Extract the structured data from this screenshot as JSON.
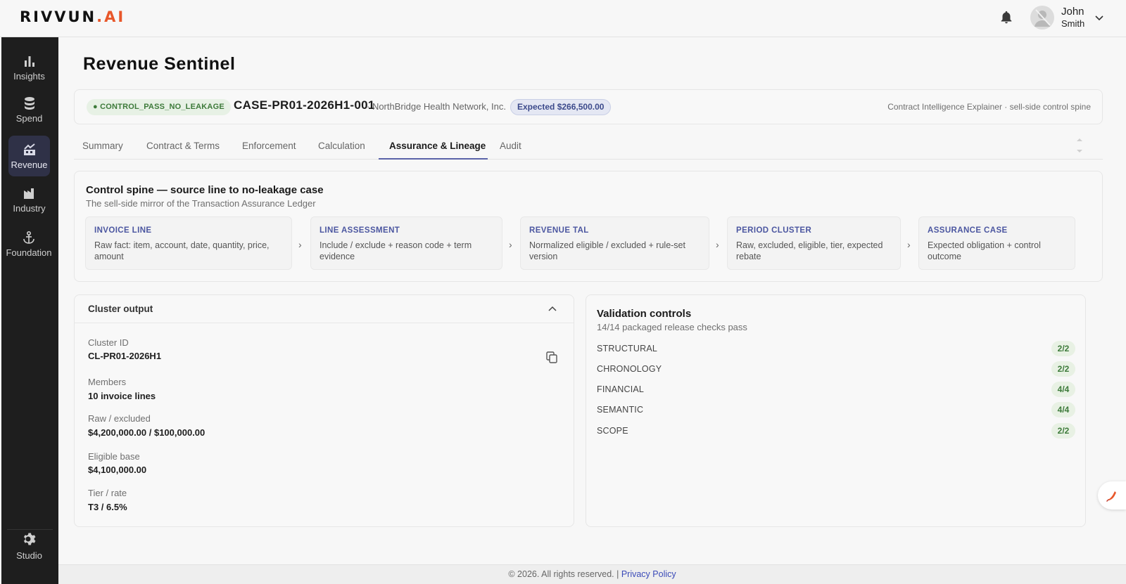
{
  "brand": {
    "logo_main": "RIVVUN",
    "logo_suffix": ".AI",
    "accent": "#e8572a"
  },
  "user": {
    "first_name": "John",
    "last_name": "Smith"
  },
  "sidebar": {
    "items": [
      {
        "label": "Insights",
        "icon": "bar-chart-icon"
      },
      {
        "label": "Spend",
        "icon": "database-stack-icon"
      },
      {
        "label": "Revenue",
        "icon": "revenue-icon",
        "active": true
      },
      {
        "label": "Industry",
        "icon": "factory-icon"
      },
      {
        "label": "Foundation",
        "icon": "anchor-icon"
      }
    ],
    "studio": {
      "label": "Studio",
      "icon": "gear-icon"
    }
  },
  "page": {
    "title": "Revenue Sentinel"
  },
  "case": {
    "status": "CONTROL_PASS_NO_LEAKAGE",
    "id": "CASE-PR01-2026H1-001",
    "org": "· NorthBridge Health Network, Inc.",
    "expected": "Expected $266,500.00",
    "subtitle": "Contract Intelligence Explainer · sell-side control spine"
  },
  "tabs": [
    {
      "label": "Summary"
    },
    {
      "label": "Contract & Terms"
    },
    {
      "label": "Enforcement"
    },
    {
      "label": "Calculation"
    },
    {
      "label": "Assurance & Lineage",
      "active": true
    },
    {
      "label": "Audit"
    }
  ],
  "spine": {
    "title": "Control spine — source line to no-leakage case",
    "subtitle": "The sell-side mirror of the Transaction Assurance Ledger",
    "steps": [
      {
        "title": "INVOICE LINE",
        "desc": "Raw fact: item, account, date, quantity, price, amount"
      },
      {
        "title": "LINE ASSESSMENT",
        "desc": "Include / exclude + reason code + term evidence"
      },
      {
        "title": "REVENUE TAL",
        "desc": "Normalized eligible / excluded + rule-set version"
      },
      {
        "title": "PERIOD CLUSTER",
        "desc": "Raw, excluded, eligible, tier, expected rebate"
      },
      {
        "title": "ASSURANCE CASE",
        "desc": "Expected obligation + control outcome"
      }
    ]
  },
  "cluster": {
    "title": "Cluster output",
    "fields": [
      {
        "label": "Cluster ID",
        "value": "CL-PR01-2026H1"
      },
      {
        "label": "Members",
        "value": "10 invoice lines"
      },
      {
        "label": "Raw / excluded",
        "value": "$4,200,000.00 / $100,000.00"
      },
      {
        "label": "Eligible base",
        "value": "$4,100,000.00"
      },
      {
        "label": "Tier / rate",
        "value": "T3 / 6.5%"
      }
    ]
  },
  "validation": {
    "title": "Validation controls",
    "subtitle": "14/14 packaged release checks pass",
    "rows": [
      {
        "name": "STRUCTURAL",
        "score": "2/2"
      },
      {
        "name": "CHRONOLOGY",
        "score": "2/2"
      },
      {
        "name": "FINANCIAL",
        "score": "4/4"
      },
      {
        "name": "SEMANTIC",
        "score": "4/4"
      },
      {
        "name": "SCOPE",
        "score": "2/2"
      }
    ]
  },
  "footer": {
    "copyright": "© 2026. All rights reserved. |",
    "privacy": "Privacy Policy"
  }
}
